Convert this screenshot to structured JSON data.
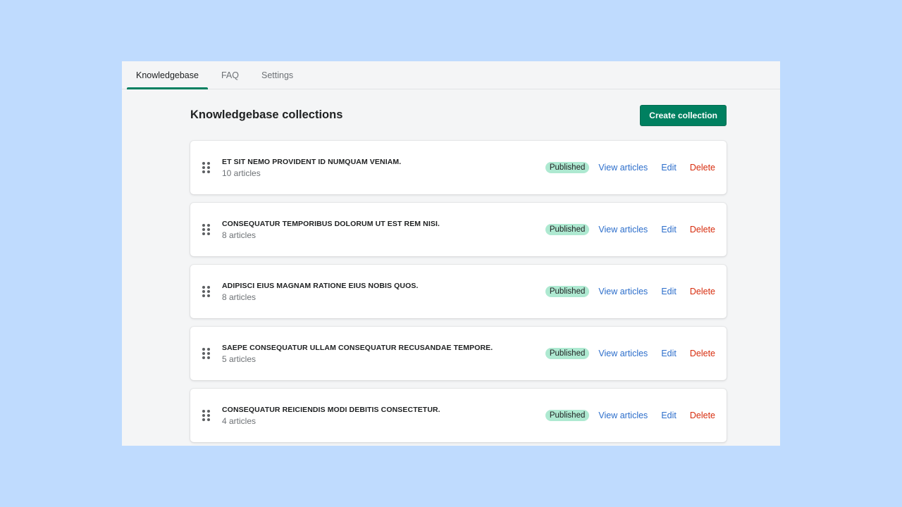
{
  "tabs": [
    {
      "label": "Knowledgebase",
      "active": true
    },
    {
      "label": "FAQ",
      "active": false
    },
    {
      "label": "Settings",
      "active": false
    }
  ],
  "header": {
    "title": "Knowledgebase collections",
    "create_label": "Create collection"
  },
  "collections": [
    {
      "title": "ET SIT NEMO PROVIDENT ID NUMQUAM VENIAM.",
      "count": "10 articles",
      "status": "Published",
      "view_label": "View articles",
      "edit_label": "Edit",
      "delete_label": "Delete"
    },
    {
      "title": "CONSEQUATUR TEMPORIBUS DOLORUM UT EST REM NISI.",
      "count": "8 articles",
      "status": "Published",
      "view_label": "View articles",
      "edit_label": "Edit",
      "delete_label": "Delete"
    },
    {
      "title": "ADIPISCI EIUS MAGNAM RATIONE EIUS NOBIS QUOS.",
      "count": "8 articles",
      "status": "Published",
      "view_label": "View articles",
      "edit_label": "Edit",
      "delete_label": "Delete"
    },
    {
      "title": "SAEPE CONSEQUATUR ULLAM CONSEQUATUR RECUSANDAE TEMPORE.",
      "count": "5 articles",
      "status": "Published",
      "view_label": "View articles",
      "edit_label": "Edit",
      "delete_label": "Delete"
    },
    {
      "title": "CONSEQUATUR REICIENDIS MODI DEBITIS CONSECTETUR.",
      "count": "4 articles",
      "status": "Published",
      "view_label": "View articles",
      "edit_label": "Edit",
      "delete_label": "Delete"
    }
  ],
  "colors": {
    "accent": "#008060",
    "badge_bg": "#aee9d1",
    "link": "#2c6ecb",
    "danger": "#d72c0d",
    "background": "#bfdbfe"
  },
  "icons": {
    "drag": "drag-handle-icon"
  }
}
